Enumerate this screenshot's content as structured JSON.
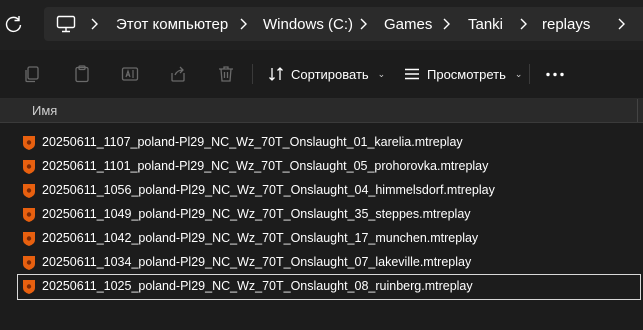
{
  "address": {
    "breadcrumbs": [
      {
        "label": "Этот компьютер"
      },
      {
        "label": "Windows (C:)"
      },
      {
        "label": "Games"
      },
      {
        "label": "Tanki"
      },
      {
        "label": "replays"
      }
    ]
  },
  "toolbar": {
    "sort_label": "Сортировать",
    "view_label": "Просмотреть"
  },
  "columns": {
    "name": "Имя"
  },
  "files": [
    {
      "name": "20250611_1107_poland-Pl29_NC_Wz_70T_Onslaught_01_karelia.mtreplay"
    },
    {
      "name": "20250611_1101_poland-Pl29_NC_Wz_70T_Onslaught_05_prohorovka.mtreplay"
    },
    {
      "name": "20250611_1056_poland-Pl29_NC_Wz_70T_Onslaught_04_himmelsdorf.mtreplay"
    },
    {
      "name": "20250611_1049_poland-Pl29_NC_Wz_70T_Onslaught_35_steppes.mtreplay"
    },
    {
      "name": "20250611_1042_poland-Pl29_NC_Wz_70T_Onslaught_17_munchen.mtreplay"
    },
    {
      "name": "20250611_1034_poland-Pl29_NC_Wz_70T_Onslaught_07_lakeville.mtreplay"
    },
    {
      "name": "20250611_1025_poland-Pl29_NC_Wz_70T_Onslaught_08_ruinberg.mtreplay"
    }
  ],
  "selected_index": 6,
  "colors": {
    "file_icon": "#e8600f",
    "background": "#1c1c1c",
    "address_bar": "#2b2b2b"
  }
}
